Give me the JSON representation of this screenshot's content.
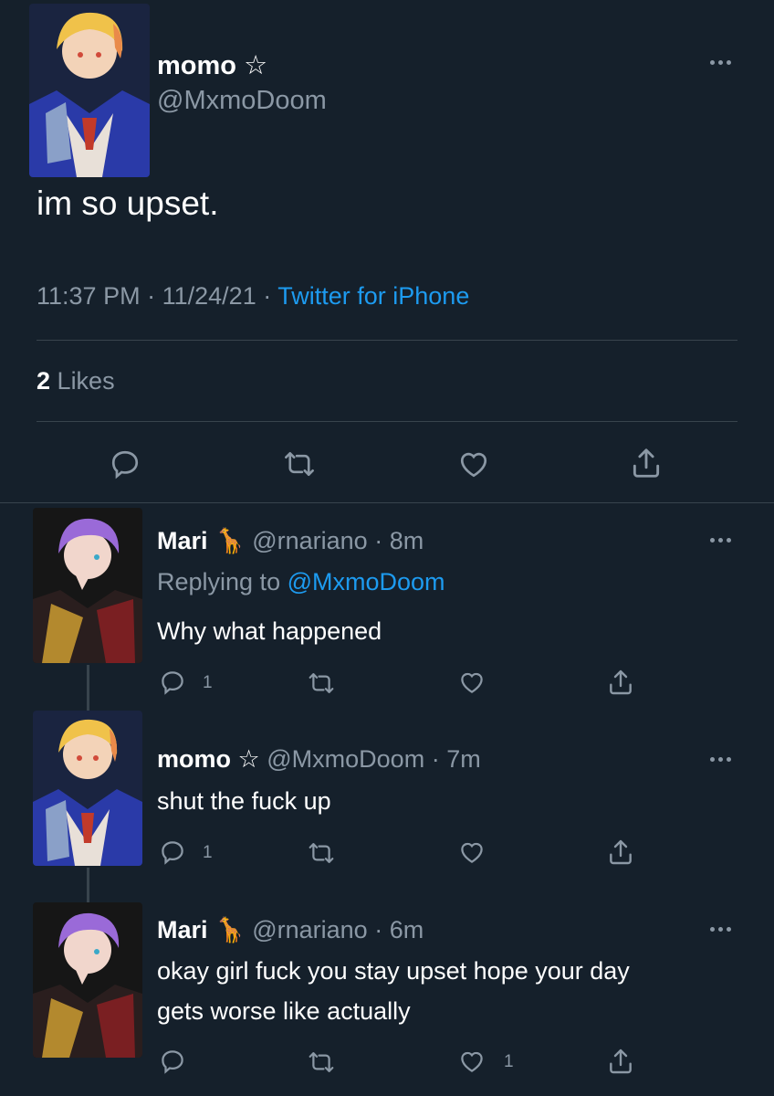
{
  "main_tweet": {
    "display_name": "momo",
    "name_badge": "☆",
    "handle": "@MxmoDoom",
    "text": "im so upset.",
    "time": "11:37 PM",
    "date": "11/24/21",
    "source": "Twitter for iPhone",
    "likes_count": "2",
    "likes_label": "Likes"
  },
  "replies": [
    {
      "display_name": "Mari",
      "name_emoji": "🦒",
      "handle": "@rnariano",
      "age": "8m",
      "replying_prefix": "Replying to",
      "replying_to": "@MxmoDoom",
      "text": "Why what happened",
      "reply_count": "1",
      "like_count": ""
    },
    {
      "display_name": "momo",
      "name_badge": "☆",
      "handle": "@MxmoDoom",
      "age": "7m",
      "text": "shut the fuck up",
      "reply_count": "1",
      "like_count": ""
    },
    {
      "display_name": "Mari",
      "name_emoji": "🦒",
      "handle": "@rnariano",
      "age": "6m",
      "text_line1": "okay girl fuck you stay upset hope your day",
      "text_line2": "gets worse like actually",
      "reply_count": "",
      "like_count": "1"
    }
  ],
  "separator": "·",
  "colors": {
    "background": "#15202b",
    "text": "#ffffff",
    "muted": "#8b98a5",
    "link": "#1d9bf0",
    "divider": "#38444d"
  },
  "icons": [
    "reply-icon",
    "retweet-icon",
    "like-icon",
    "share-icon",
    "more-icon",
    "giraffe-emoji"
  ]
}
